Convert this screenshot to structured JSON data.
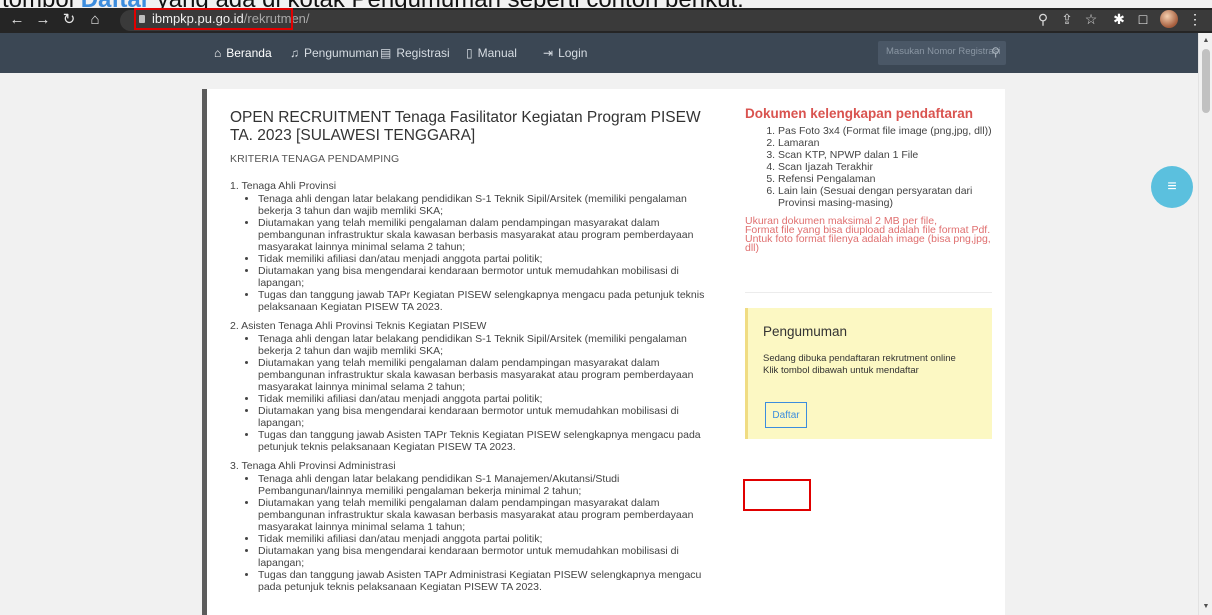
{
  "caption": {
    "before": "tombol ",
    "highlight": "Daftar",
    "after": " yang ada di kotak Pengumuman seperti contoh berikut:"
  },
  "browser": {
    "url_domain": "ibmpkp.pu.go.id",
    "url_path": "/rekrutmen/",
    "icons": [
      "back-icon",
      "forward-icon",
      "reload-icon",
      "home-icon",
      "zoom-icon",
      "share-icon",
      "star-icon",
      "extensions-icon",
      "sidepanel-icon",
      "profile-avatar",
      "menu-icon"
    ]
  },
  "navbar": {
    "items": [
      {
        "label": "Beranda",
        "icon": "home-icon"
      },
      {
        "label": "Pengumuman",
        "icon": "bell-icon"
      },
      {
        "label": "Registrasi",
        "icon": "registration-icon"
      },
      {
        "label": "Manual",
        "icon": "document-icon"
      },
      {
        "label": "Login",
        "icon": "login-icon"
      }
    ],
    "search_placeholder": "Masukan Nomor Registrasi"
  },
  "post": {
    "title": "OPEN RECRUITMENT Tenaga Fasilitator Kegiatan Program PISEW TA. 2023 [SULAWESI TENGGARA]",
    "subtitle": "KRITERIA TENAGA PENDAMPING",
    "sections": [
      {
        "title": "1. Tenaga Ahli Provinsi",
        "items": [
          "Tenaga ahli dengan latar belakang pendidikan S-1 Teknik Sipil/Arsitek (memiliki pengalaman bekerja 3 tahun dan wajib memliki SKA;",
          "Diutamakan yang telah memiliki pengalaman dalam pendampingan masyarakat dalam pembangunan infrastruktur skala kawasan berbasis masyarakat atau program pemberdayaan masyarakat lainnya minimal selama 2 tahun;",
          "Tidak memiliki afiliasi dan/atau menjadi anggota partai politik;",
          "Diutamakan yang bisa mengendarai kendaraan bermotor untuk memudahkan mobilisasi di lapangan;",
          "Tugas dan tanggung jawab TAPr Kegiatan PISEW selengkapnya mengacu pada petunjuk teknis pelaksanaan Kegiatan PISEW TA 2023."
        ]
      },
      {
        "title": "2. Asisten Tenaga Ahli Provinsi Teknis Kegiatan PISEW",
        "items": [
          "Tenaga ahli dengan latar belakang pendidikan S-1 Teknik Sipil/Arsitek (memiliki pengalaman bekerja 2 tahun dan wajib memliki SKA;",
          "Diutamakan yang telah memiliki pengalaman dalam pendampingan masyarakat dalam pembangunan infrastruktur skala kawasan berbasis masyarakat atau program pemberdayaan masyarakat lainnya minimal selama 2 tahun;",
          "Tidak memiliki afiliasi dan/atau menjadi anggota partai politik;",
          "Diutamakan yang bisa mengendarai kendaraan bermotor untuk memudahkan mobilisasi di lapangan;",
          "Tugas dan tanggung jawab Asisten TAPr Teknis Kegiatan PISEW selengkapnya mengacu pada petunjuk teknis pelaksanaan Kegiatan PISEW TA 2023."
        ]
      },
      {
        "title": "3. Tenaga Ahli Provinsi Administrasi",
        "items": [
          "Tenaga ahli dengan latar belakang pendidikan S-1 Manajemen/Akutansi/Studi Pembangunan/lainnya memiliki pengalaman bekerja minimal 2 tahun;",
          "Diutamakan yang telah memiliki pengalaman dalam pendampingan masyarakat dalam pembangunan infrastruktur skala kawasan berbasis masyarakat atau program pemberdayaan masyarakat lainnya minimal selama 1 tahun;",
          "Tidak memiliki afiliasi dan/atau menjadi anggota partai politik;",
          "Diutamakan yang bisa mengendarai kendaraan bermotor untuk memudahkan mobilisasi di lapangan;",
          "Tugas dan tanggung jawab Asisten TAPr Administrasi Kegiatan PISEW selengkapnya mengacu pada petunjuk teknis pelaksanaan Kegiatan PISEW TA 2023."
        ]
      }
    ]
  },
  "documents": {
    "title": "Dokumen kelengkapan pendaftaran",
    "items": [
      "Pas Foto 3x4 (Format file image (png,jpg, dll))",
      "Lamaran",
      "Scan KTP, NPWP dalan 1 File",
      "Scan Ijazah Terakhir",
      "Refensi Pengalaman",
      "Lain lain (Sesuai dengan persyaratan dari Provinsi masing-masing)"
    ],
    "note": "Ukuran dokumen maksimal 2 MB per file,\nFormat file yang bisa diupload adalah file format Pdf.\nUntuk foto format filenya adalah image (bisa png,jpg, dll)"
  },
  "announcement": {
    "title": "Pengumuman",
    "line1": "Sedang dibuka pendaftaran rekrutment online",
    "line2": "Klik tombol dibawah untuk mendaftar",
    "button": "Daftar"
  },
  "colors": {
    "navbar": "#3b4754",
    "accent": "#3c8dde",
    "doc_title": "#d9534f",
    "announcement_bg": "#fcf8c3",
    "highlight_box": "#e00000",
    "fab": "#5bc0de"
  }
}
